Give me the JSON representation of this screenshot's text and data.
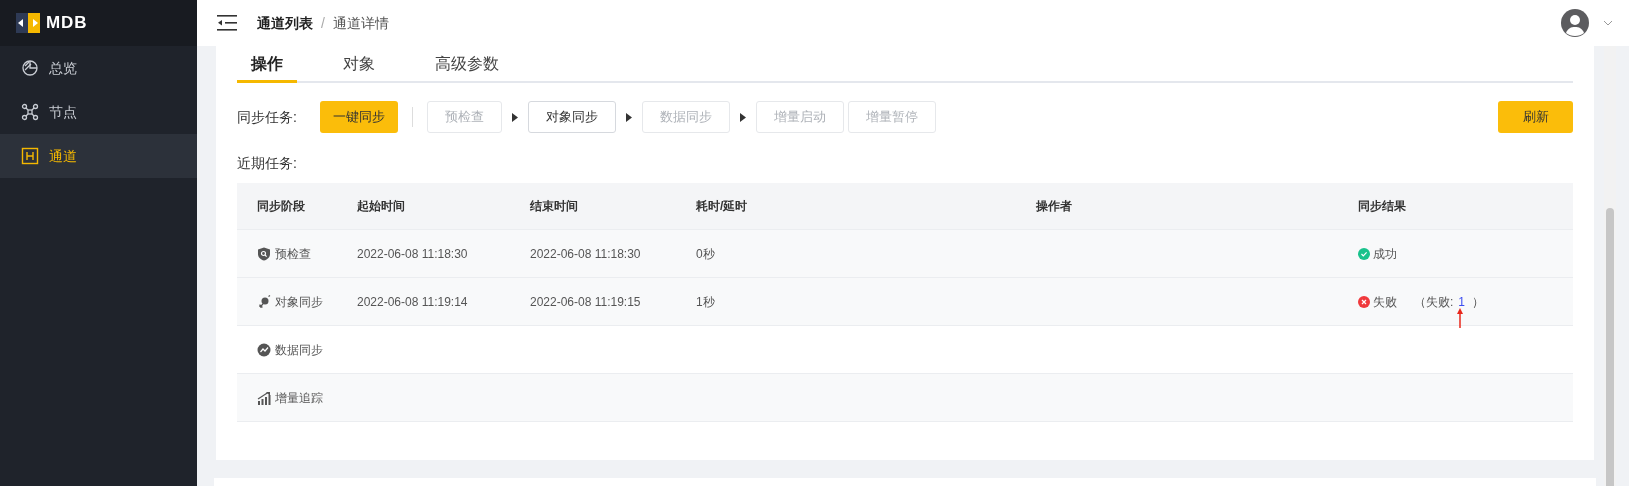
{
  "logo": {
    "text": "MDB"
  },
  "sidebar": {
    "items": [
      {
        "label": "总览",
        "selected": false
      },
      {
        "label": "节点",
        "selected": false
      },
      {
        "label": "通道",
        "selected": true
      }
    ]
  },
  "breadcrumb": [
    "通道列表",
    "通道详情"
  ],
  "breadcrumb_separator": "/",
  "tabs": [
    {
      "label": "操作",
      "selected": true
    },
    {
      "label": "对象",
      "selected": false
    },
    {
      "label": "高级参数",
      "selected": false
    }
  ],
  "sync_tasks": {
    "label": "同步任务:",
    "one_click": "一键同步",
    "refresh": "刷新",
    "steps": [
      {
        "label": "预检查",
        "disabled": true,
        "arrow_after": true
      },
      {
        "label": "对象同步",
        "disabled": false,
        "arrow_after": true
      },
      {
        "label": "数据同步",
        "disabled": true,
        "arrow_after": true
      },
      {
        "label": "增量启动",
        "disabled": true,
        "arrow_after": false
      },
      {
        "label": "增量暂停",
        "disabled": true,
        "arrow_after": false
      }
    ]
  },
  "recent_tasks": {
    "label": "近期任务:",
    "columns": [
      "同步阶段",
      "起始时间",
      "结束时间",
      "耗时/延时",
      "操作者",
      "同步结果"
    ],
    "rows": [
      {
        "stage": "预检查",
        "start": "2022-06-08 11:18:30",
        "end": "2022-06-08 11:18:30",
        "duration": "0秒",
        "result": {
          "kind": "success",
          "text": "成功"
        }
      },
      {
        "stage": "对象同步",
        "start": "2022-06-08 11:19:14",
        "end": "2022-06-08 11:19:15",
        "duration": "1秒",
        "result": {
          "kind": "fail",
          "text": "失败",
          "detail_prefix": "（失败:",
          "count": "1",
          "detail_suffix": "）"
        }
      },
      {
        "stage": "数据同步"
      },
      {
        "stage": "增量追踪"
      }
    ]
  }
}
